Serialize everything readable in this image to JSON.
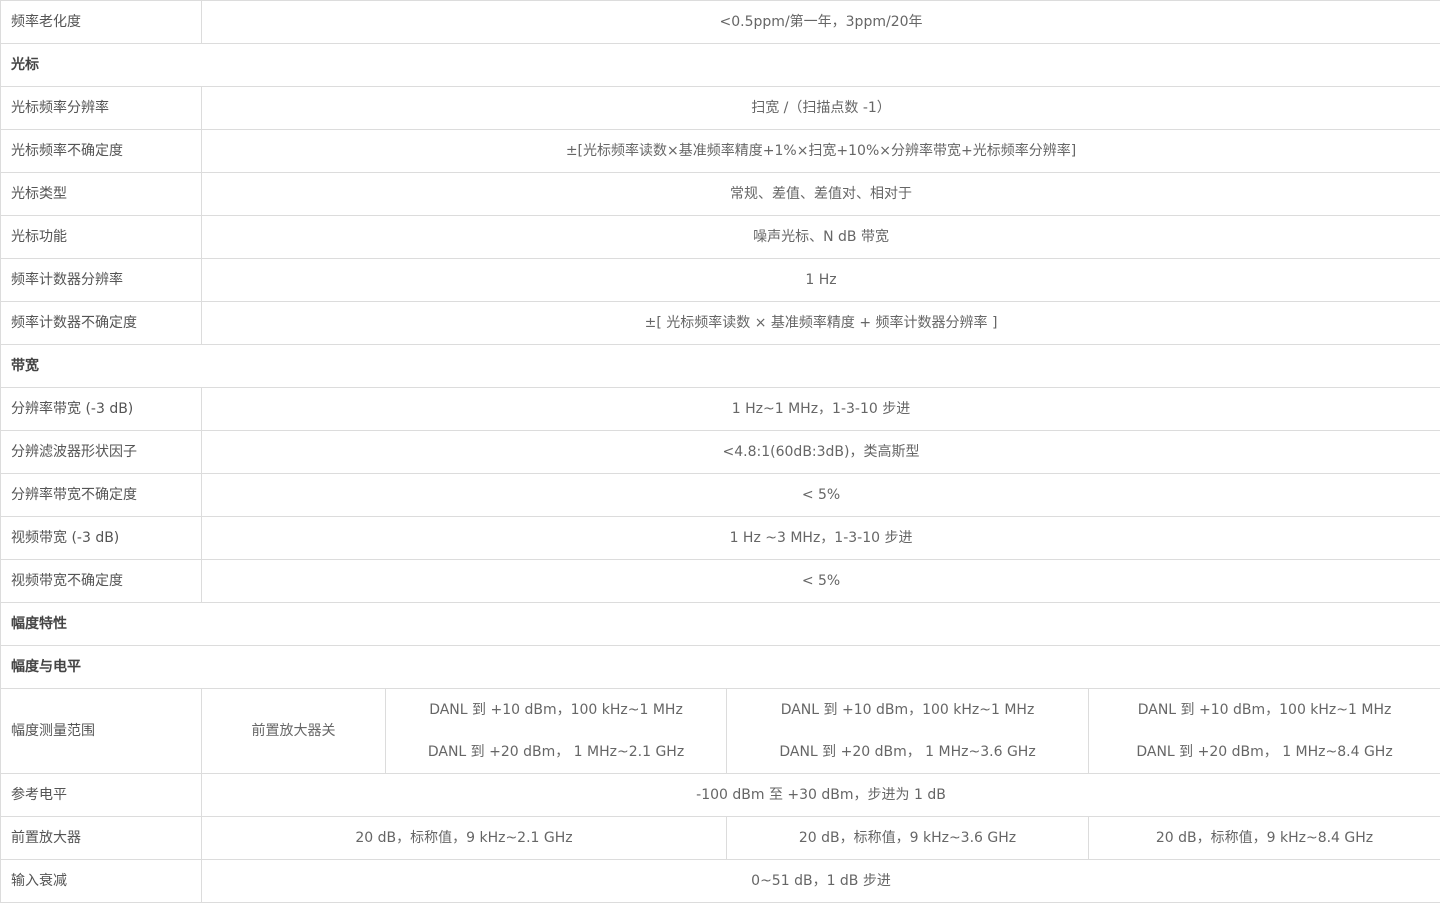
{
  "rows": {
    "aging": {
      "label": "频率老化度",
      "value": "<0.5ppm/第一年，3ppm/20年"
    },
    "cursor_section": "光标",
    "cursor_res": {
      "label": "光标频率分辨率",
      "value": "扫宽 /（扫描点数 -1）"
    },
    "cursor_unc": {
      "label": "光标频率不确定度",
      "value": "±[光标频率读数×基准频率精度+1%×扫宽+10%×分辨率带宽+光标频率分辨率]"
    },
    "cursor_type": {
      "label": "光标类型",
      "value": "常规、差值、差值对、相对于"
    },
    "cursor_func": {
      "label": "光标功能",
      "value": "噪声光标、N dB 带宽"
    },
    "counter_res": {
      "label": "频率计数器分辨率",
      "value": "1 Hz"
    },
    "counter_unc": {
      "label": "频率计数器不确定度",
      "value": "±[ 光标频率读数 × 基准频率精度 + 频率计数器分辨率 ]"
    },
    "bw_section": "带宽",
    "rbw": {
      "label": "分辨率带宽 (-3 dB)",
      "value": "1 Hz~1 MHz，1-3-10 步进"
    },
    "shape": {
      "label": "分辨滤波器形状因子",
      "value": "<4.8:1(60dB:3dB)，类高斯型"
    },
    "rbw_unc": {
      "label": "分辨率带宽不确定度",
      "value": "< 5%"
    },
    "vbw": {
      "label": "视频带宽 (-3 dB)",
      "value": "1 Hz ~3 MHz，1-3-10 步进"
    },
    "vbw_unc": {
      "label": "视频带宽不确定度",
      "value": "< 5%"
    },
    "amp_section": "幅度特性",
    "amp_level_section": "幅度与电平",
    "amp_range": {
      "label": "幅度测量范围",
      "sub_label": "前置放大器关",
      "cols": [
        {
          "line1": "DANL 到 +10 dBm，100 kHz~1 MHz",
          "line2": "DANL 到 +20 dBm， 1 MHz~2.1 GHz"
        },
        {
          "line1": "DANL 到 +10 dBm，100 kHz~1 MHz",
          "line2": "DANL 到 +20 dBm， 1 MHz~3.6 GHz"
        },
        {
          "line1": "DANL 到 +10 dBm，100 kHz~1 MHz",
          "line2": "DANL 到 +20 dBm， 1 MHz~8.4 GHz"
        }
      ]
    },
    "ref_level": {
      "label": "参考电平",
      "value": "-100 dBm 至 +30 dBm，步进为 1 dB"
    },
    "preamp": {
      "label": "前置放大器",
      "cols": [
        "20 dB，标称值，9 kHz~2.1 GHz",
        "20 dB，标称值，9 kHz~3.6 GHz",
        "20 dB，标称值，9 kHz~8.4 GHz"
      ]
    },
    "atten": {
      "label": "输入衰减",
      "value": "0~51 dB，1 dB 步进"
    }
  }
}
